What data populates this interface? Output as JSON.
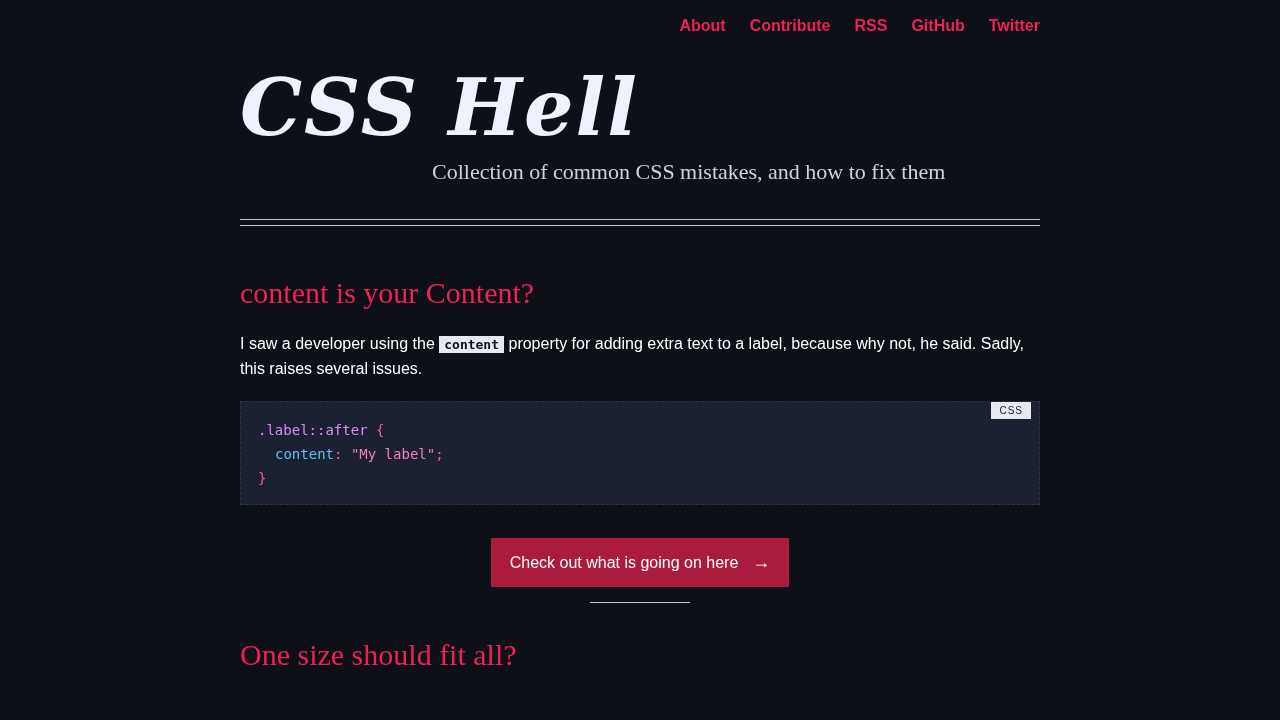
{
  "nav": [
    {
      "label": "About"
    },
    {
      "label": "Contribute"
    },
    {
      "label": "RSS"
    },
    {
      "label": "GitHub"
    },
    {
      "label": "Twitter"
    }
  ],
  "site": {
    "title": "CSS Hell",
    "tagline": "Collection of common CSS mistakes, and how to fix them"
  },
  "articles": [
    {
      "heading": "content is your Content?",
      "paragraph": [
        {
          "kind": "text",
          "text": "I saw a developer using the "
        },
        {
          "kind": "code",
          "text": "content"
        },
        {
          "kind": "text",
          "text": " property for adding extra text to a label, because why not, he said. Sadly, this raises several issues."
        }
      ],
      "code_block": {
        "language": "CSS",
        "lines": [
          [
            {
              "kind": "selector",
              "text": ".label::after"
            },
            {
              "kind": "punct",
              "text": " {"
            }
          ],
          [
            {
              "kind": "indent"
            },
            {
              "kind": "property",
              "text": "content"
            },
            {
              "kind": "punct",
              "text": ": "
            },
            {
              "kind": "string",
              "text": "\"My label\""
            },
            {
              "kind": "punct",
              "text": ";"
            }
          ],
          [
            {
              "kind": "punct",
              "text": "}"
            }
          ]
        ]
      },
      "button": {
        "label": "Check out what is going on here",
        "icon": "→"
      }
    },
    {
      "heading": "One size should fit all?"
    }
  ]
}
